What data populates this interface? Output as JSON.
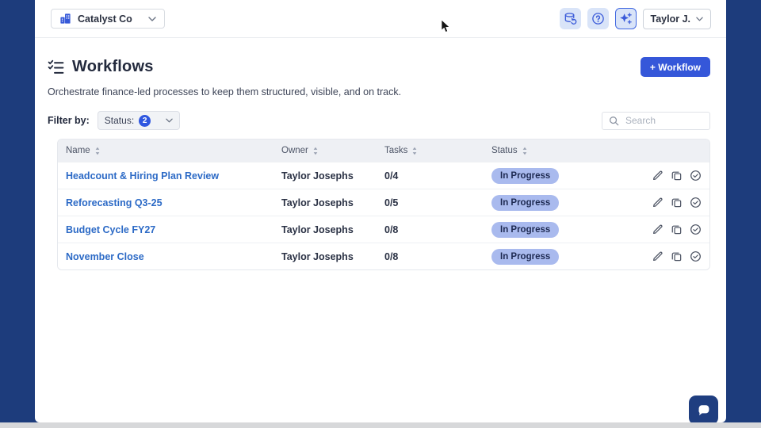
{
  "topbar": {
    "company_selector": {
      "label": "Catalyst Co"
    },
    "icon_buttons": [
      {
        "name": "data-sync"
      },
      {
        "name": "help"
      },
      {
        "name": "ai-assistant",
        "active": true
      }
    ],
    "user_menu": {
      "label": "Taylor J."
    }
  },
  "page": {
    "title": "Workflows",
    "subtitle": "Orchestrate finance-led processes to keep them structured, visible, and on track.",
    "create_button_label": "+ Workflow"
  },
  "filter_bar": {
    "label": "Filter by:",
    "status_dropdown": {
      "label": "Status:",
      "selected_count": "2"
    },
    "search": {
      "placeholder": "Search"
    }
  },
  "table": {
    "columns": [
      "Name",
      "Owner",
      "Tasks",
      "Status"
    ],
    "rows": [
      {
        "name": "Headcount & Hiring Plan Review",
        "owner": "Taylor Josephs",
        "tasks": "0/4",
        "status": "In Progress"
      },
      {
        "name": "Reforecasting Q3-25",
        "owner": "Taylor Josephs",
        "tasks": "0/5",
        "status": "In Progress"
      },
      {
        "name": "Budget Cycle FY27",
        "owner": "Taylor Josephs",
        "tasks": "0/8",
        "status": "In Progress"
      },
      {
        "name": "November Close",
        "owner": "Taylor Josephs",
        "tasks": "0/8",
        "status": "In Progress"
      }
    ],
    "row_actions": [
      "edit",
      "duplicate",
      "complete"
    ]
  },
  "colors": {
    "background": "#1d3c7c",
    "primary": "#3557d9",
    "link": "#2c6ac6",
    "status_pill_bg": "#a9baee",
    "status_pill_text": "#1e2a52",
    "icon_button_bg": "#d9e4f8",
    "icon_button_fg": "#3b5bd9"
  }
}
